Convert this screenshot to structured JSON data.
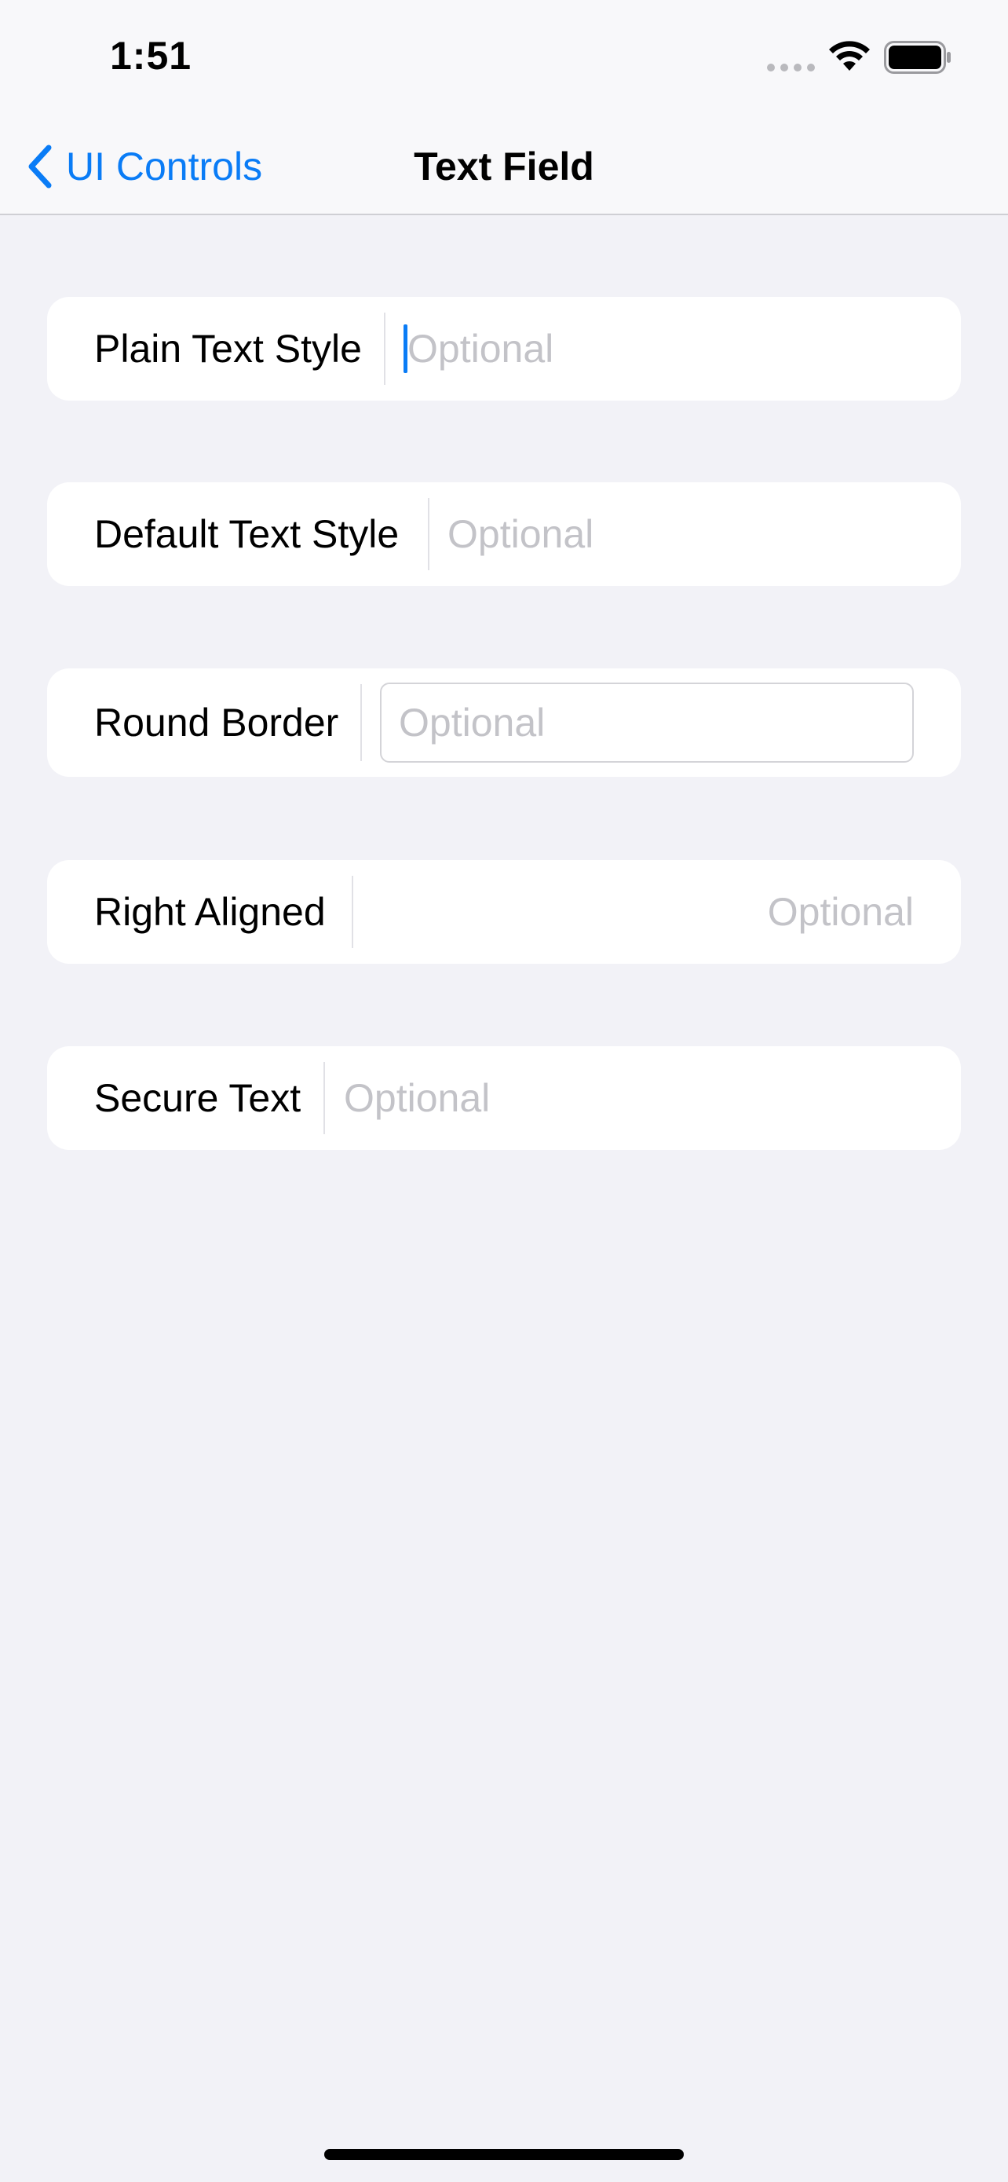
{
  "status_bar": {
    "time": "1:51",
    "icons": [
      "signal-dots-icon",
      "wifi-icon",
      "battery-icon"
    ]
  },
  "nav": {
    "back_label": "UI Controls",
    "back_icon": "chevron-left-icon",
    "title": "Text Field"
  },
  "colors": {
    "accent": "#0a7cf6",
    "background": "#f2f2f7",
    "placeholder": "#c3c3c8"
  },
  "fields": [
    {
      "label": "Plain Text Style",
      "placeholder": "Optional",
      "value": "",
      "focused": true
    },
    {
      "label": "Default Text Style",
      "placeholder": "Optional",
      "value": ""
    },
    {
      "label": "Round Border",
      "placeholder": "Optional",
      "value": ""
    },
    {
      "label": "Right Aligned",
      "placeholder": "Optional",
      "value": ""
    },
    {
      "label": "Secure Text",
      "placeholder": "Optional",
      "value": ""
    }
  ]
}
